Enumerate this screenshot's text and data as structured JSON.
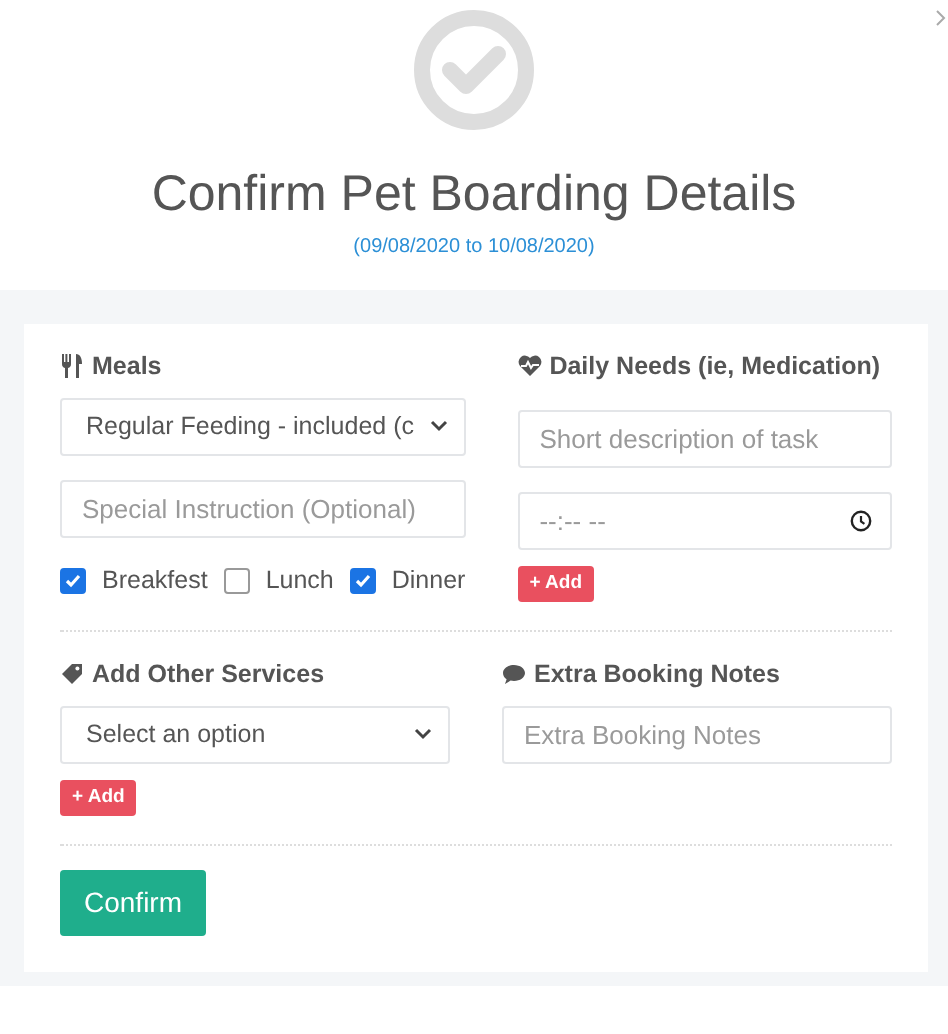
{
  "header": {
    "title": "Confirm Pet Boarding Details",
    "date_range": "(09/08/2020 to 10/08/2020)"
  },
  "meals": {
    "label": "Meals",
    "plan": "Regular Feeding - included (c",
    "instruction_placeholder": "Special Instruction (Optional)",
    "times": [
      {
        "label": "Breakfest",
        "checked": true
      },
      {
        "label": "Lunch",
        "checked": false
      },
      {
        "label": "Dinner",
        "checked": true
      }
    ]
  },
  "daily_needs": {
    "label": "Daily Needs (ie, Medication)",
    "task_placeholder": "Short description of task",
    "time_placeholder": "--:-- --",
    "add_button": "+ Add"
  },
  "other_services": {
    "label": "Add Other Services",
    "value": "Select an option",
    "add_button": "+ Add"
  },
  "booking_notes": {
    "label": "Extra Booking Notes",
    "placeholder": "Extra Booking Notes"
  },
  "confirm_button": "Confirm"
}
